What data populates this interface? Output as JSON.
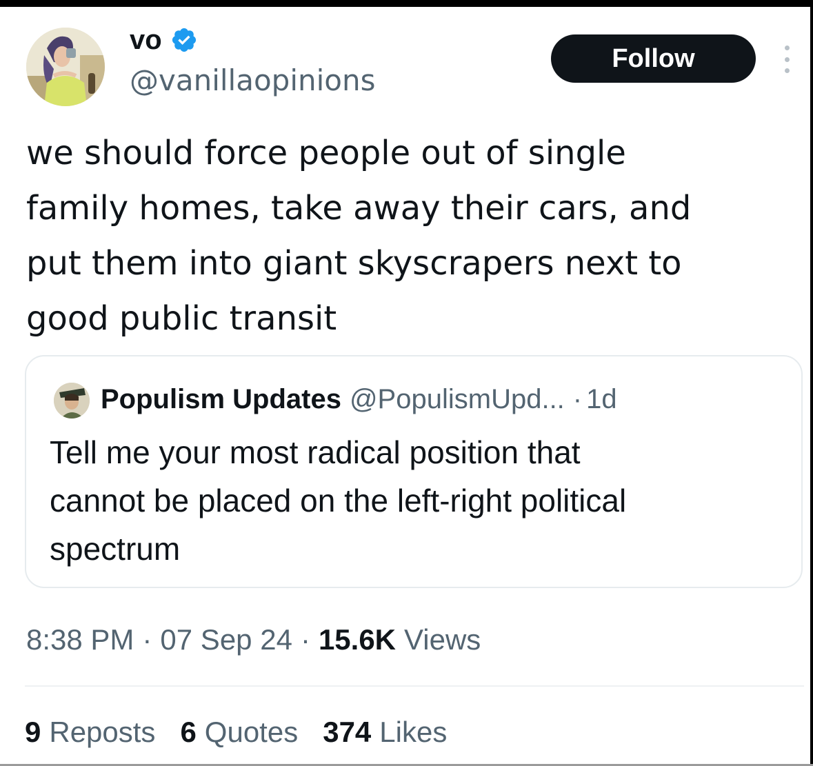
{
  "author": {
    "display_name": "vo",
    "handle": "@vanillaopinions",
    "verified_icon": "verified-badge-icon",
    "verified_color": "#1d9bf0"
  },
  "follow_button": {
    "label": "Follow"
  },
  "more_menu": {
    "icon": "more-vertical-icon"
  },
  "tweet": {
    "text": "we should force people out of single\nfamily homes, take away their cars, and\nput them into giant skyscrapers next to\ngood public transit"
  },
  "quote": {
    "display_name": "Populism Updates",
    "handle": "@PopulismUpd...",
    "separator": "·",
    "time": "1d",
    "text": "Tell me your most radical position that\ncannot be placed on the left-right political\nspectrum"
  },
  "meta": {
    "time": "8:38 PM",
    "separator": "·",
    "date": "07 Sep 24",
    "views_count": "15.6K",
    "views_label": "Views"
  },
  "stats": {
    "reposts_count": "9",
    "reposts_label": "Reposts",
    "quotes_count": "6",
    "quotes_label": "Quotes",
    "likes_count": "374",
    "likes_label": "Likes"
  },
  "colors": {
    "text_primary": "#0f1419",
    "text_secondary": "#536471",
    "button_bg": "#0f1419",
    "border": "#e6ebee"
  }
}
